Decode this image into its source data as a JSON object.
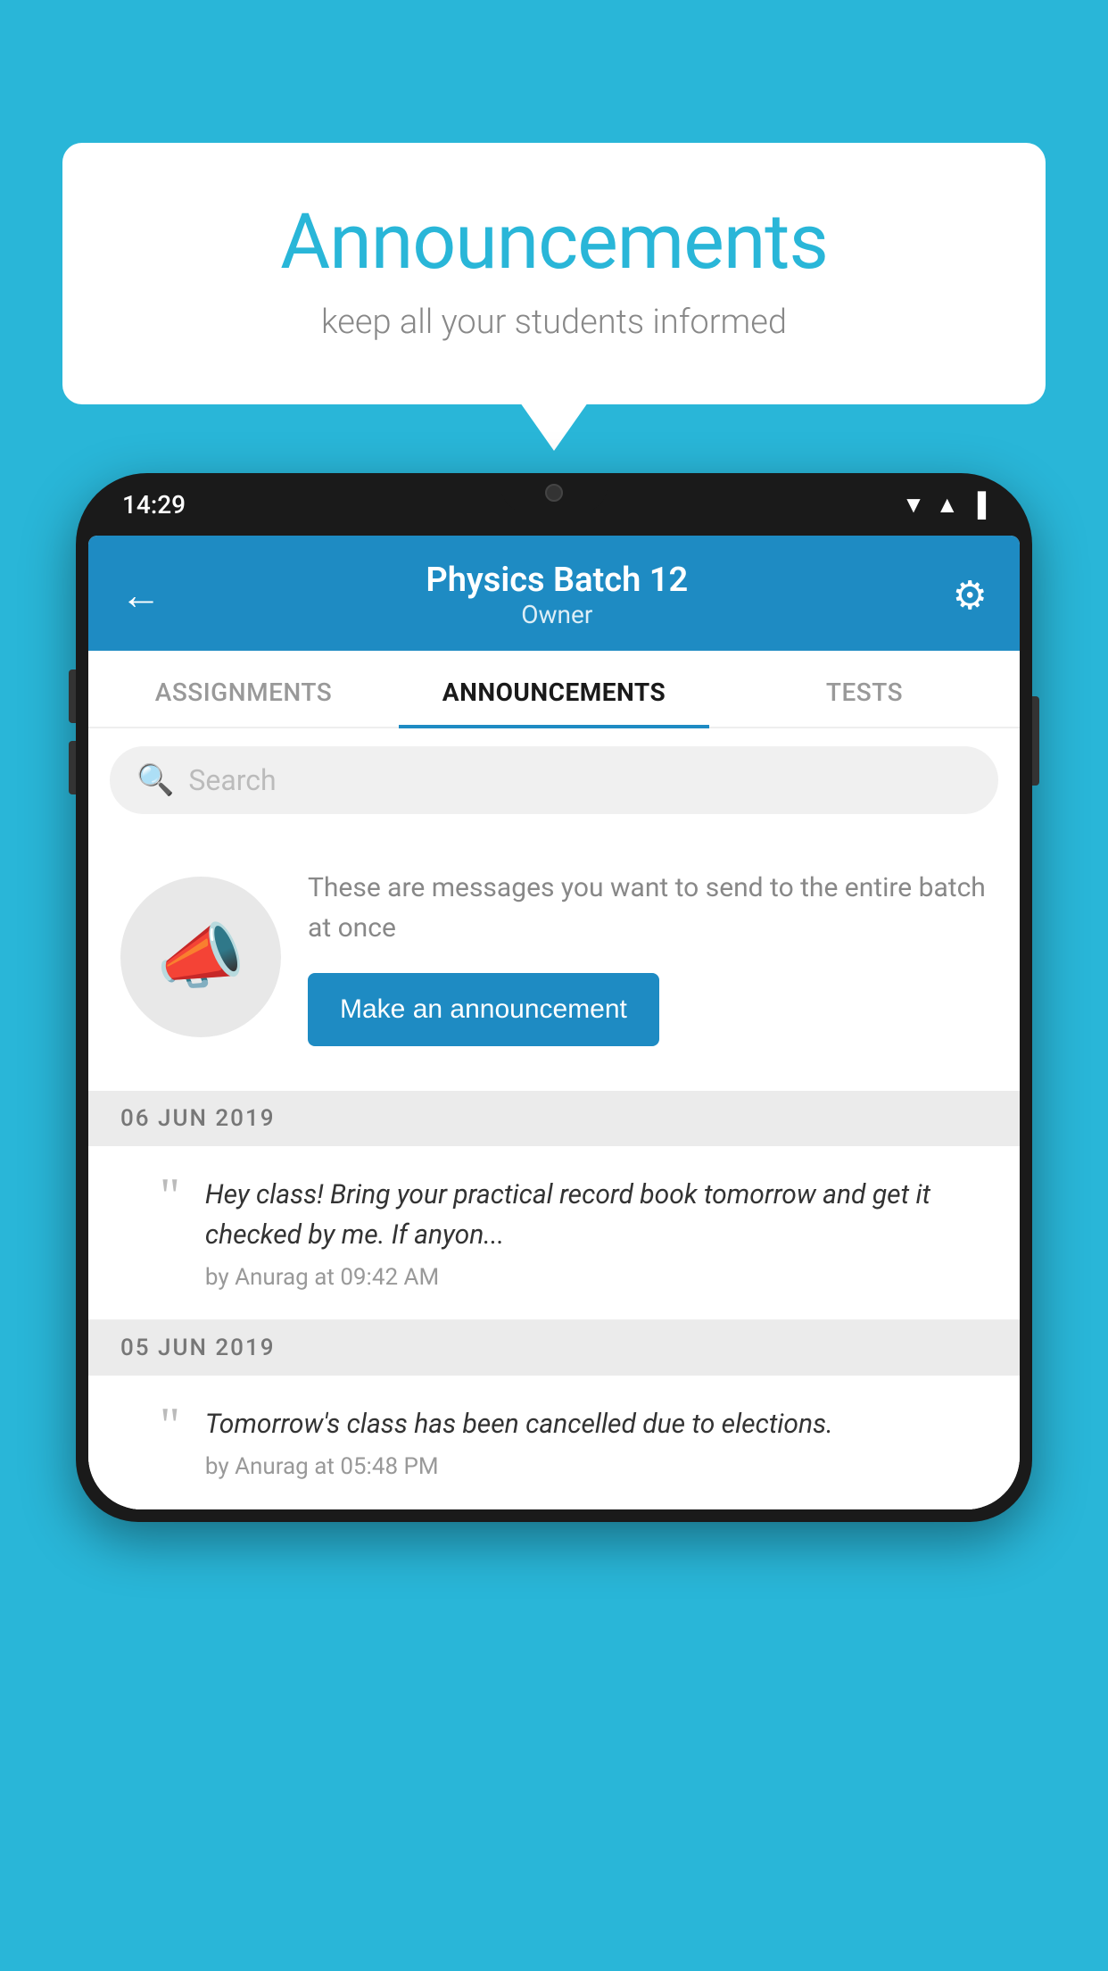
{
  "background_color": "#29B6D8",
  "speech_bubble": {
    "title": "Announcements",
    "subtitle": "keep all your students informed"
  },
  "phone": {
    "status_bar": {
      "time": "14:29",
      "icons": [
        "wifi",
        "signal",
        "battery"
      ]
    },
    "app_bar": {
      "title": "Physics Batch 12",
      "subtitle": "Owner",
      "back_label": "←",
      "settings_label": "⚙"
    },
    "tabs": [
      {
        "label": "ASSIGNMENTS",
        "active": false
      },
      {
        "label": "ANNOUNCEMENTS",
        "active": true
      },
      {
        "label": "TESTS",
        "active": false
      }
    ],
    "search": {
      "placeholder": "Search"
    },
    "promo_section": {
      "description": "These are messages you want to send to the entire batch at once",
      "button_label": "Make an announcement"
    },
    "announcements": [
      {
        "date": "06  JUN  2019",
        "message": "Hey class! Bring your practical record book tomorrow and get it checked by me. If anyon...",
        "meta": "by Anurag at 09:42 AM"
      },
      {
        "date": "05  JUN  2019",
        "message": "Tomorrow's class has been cancelled due to elections.",
        "meta": "by Anurag at 05:48 PM"
      }
    ]
  }
}
